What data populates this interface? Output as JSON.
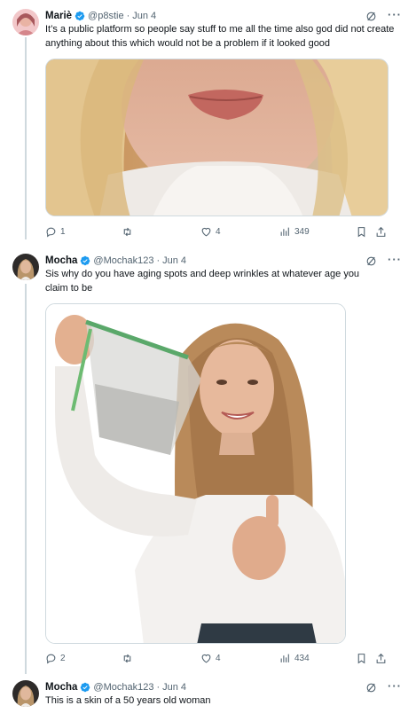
{
  "tweets": [
    {
      "author": "Mariè",
      "handle": "@p8stie",
      "separator": "·",
      "date": "Jun 4",
      "text": "It’s a public platform so people say stuff to me all the time also god did not create anything about this which would not be a problem if it looked good",
      "replies": "1",
      "retweets": "",
      "likes": "4",
      "views": "349"
    },
    {
      "author": "Mocha",
      "handle": "@Mochak123",
      "separator": "·",
      "date": "Jun 4",
      "text": "Sis why do you have aging spots and deep wrinkles at whatever age you claim to be",
      "replies": "2",
      "retweets": "",
      "likes": "4",
      "views": "434"
    },
    {
      "author": "Mocha",
      "handle": "@Mochak123",
      "separator": "·",
      "date": "Jun 4",
      "text": "This is a skin of a 50 years old woman"
    }
  ],
  "more_label": "···",
  "colors": {
    "verified": "#1d9bf0",
    "icon_gray": "#536471",
    "border": "#cfd9de"
  },
  "icons": [
    "verified-badge-icon",
    "grok-icon",
    "more-icon",
    "reply-icon",
    "retweet-icon",
    "like-icon",
    "views-icon",
    "bookmark-icon",
    "share-icon"
  ]
}
